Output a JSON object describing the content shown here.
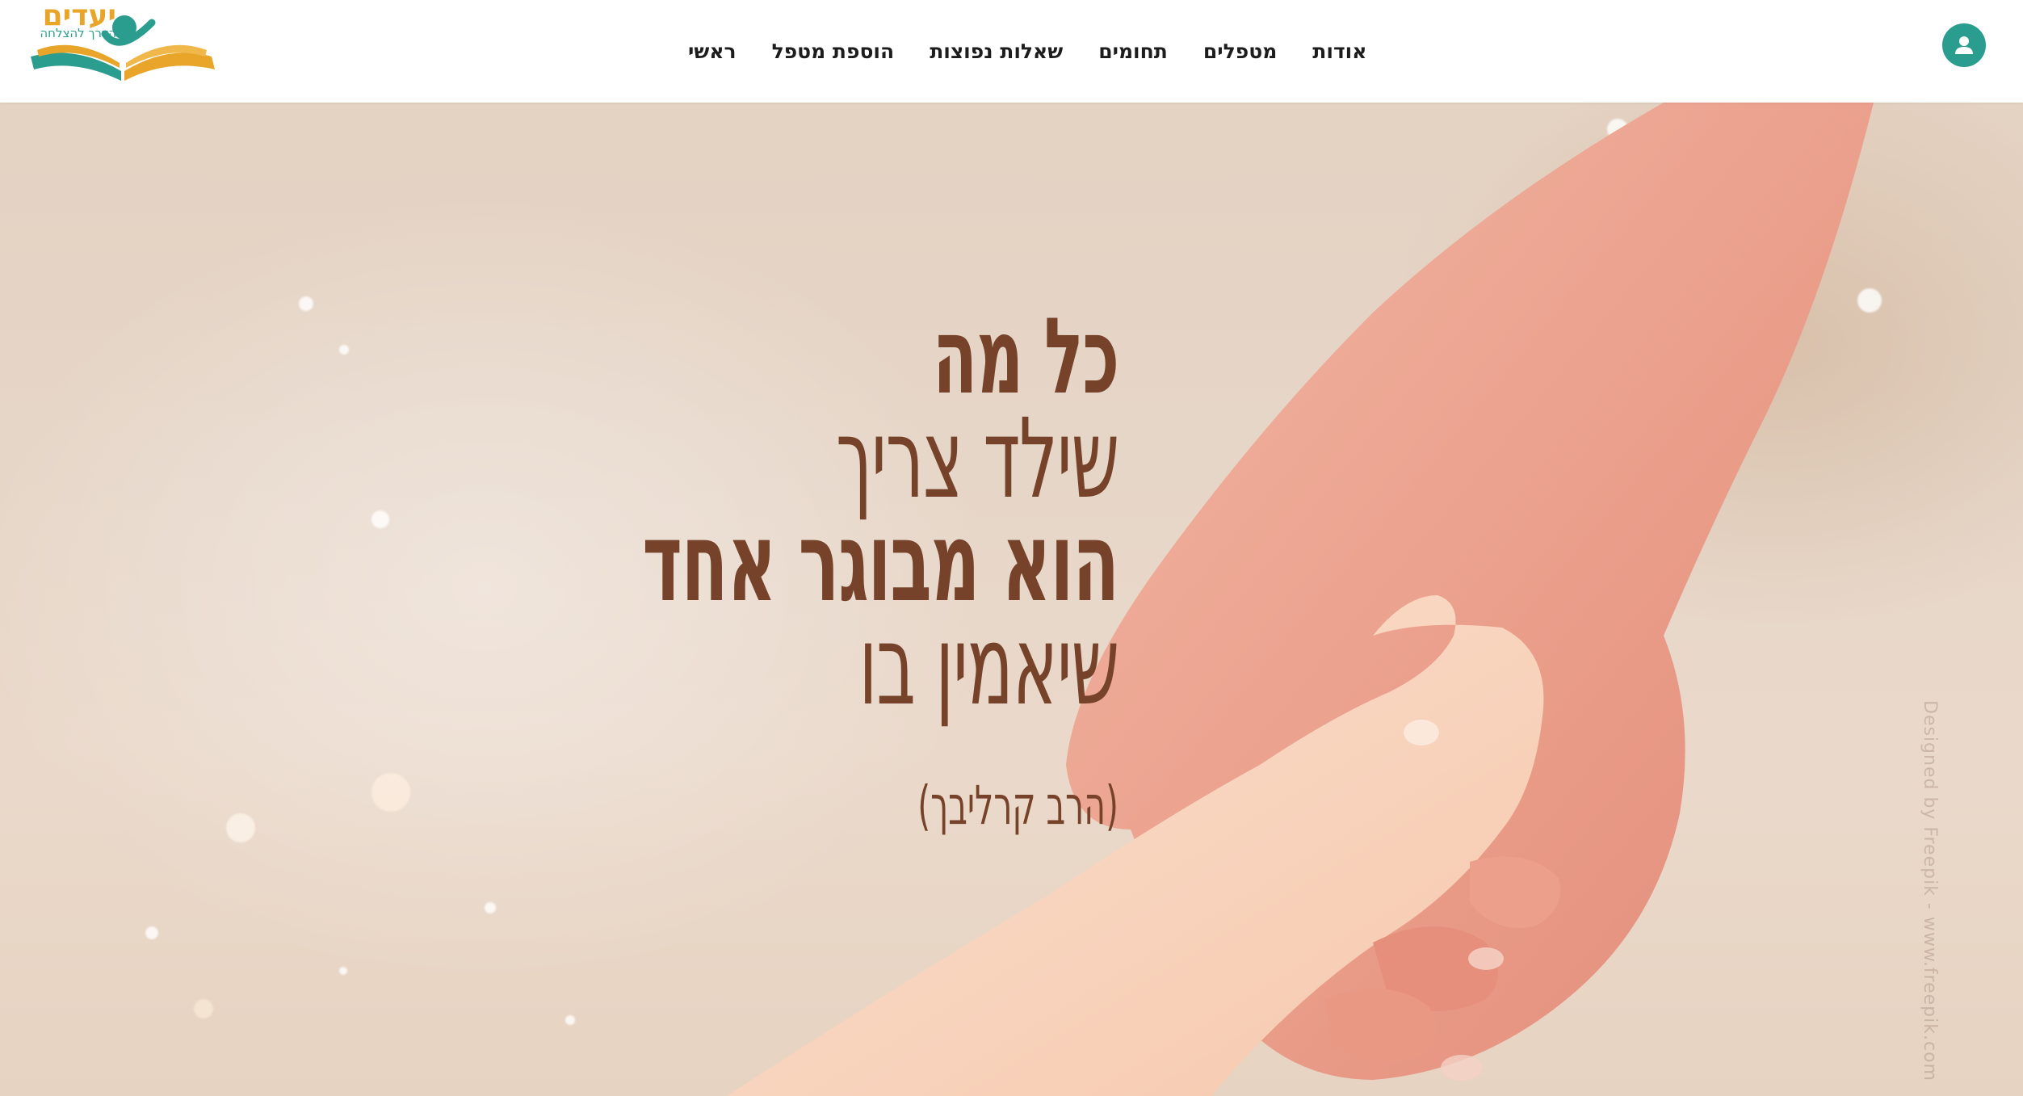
{
  "header": {
    "logo": {
      "title": "יעדים",
      "subtitle": "הדרך להצלחה"
    },
    "nav": [
      {
        "label": "ראשי"
      },
      {
        "label": "הוספת מטפל"
      },
      {
        "label": "שאלות נפוצות"
      },
      {
        "label": "תחומים"
      },
      {
        "label": "מטפלים"
      },
      {
        "label": "אודות"
      }
    ],
    "user_icon": "user-icon"
  },
  "hero": {
    "quote_lines": [
      "כל מה",
      "שילד צריך",
      "הוא מבוגר אחד",
      "שיאמין בו"
    ],
    "author": "(הרב קרליבך)",
    "watermark": "Designed by Freepik - www.freepik.com"
  },
  "colors": {
    "brand_teal": "#2a9d8f",
    "brand_orange": "#e8a52a",
    "quote_brown": "#76432a"
  }
}
